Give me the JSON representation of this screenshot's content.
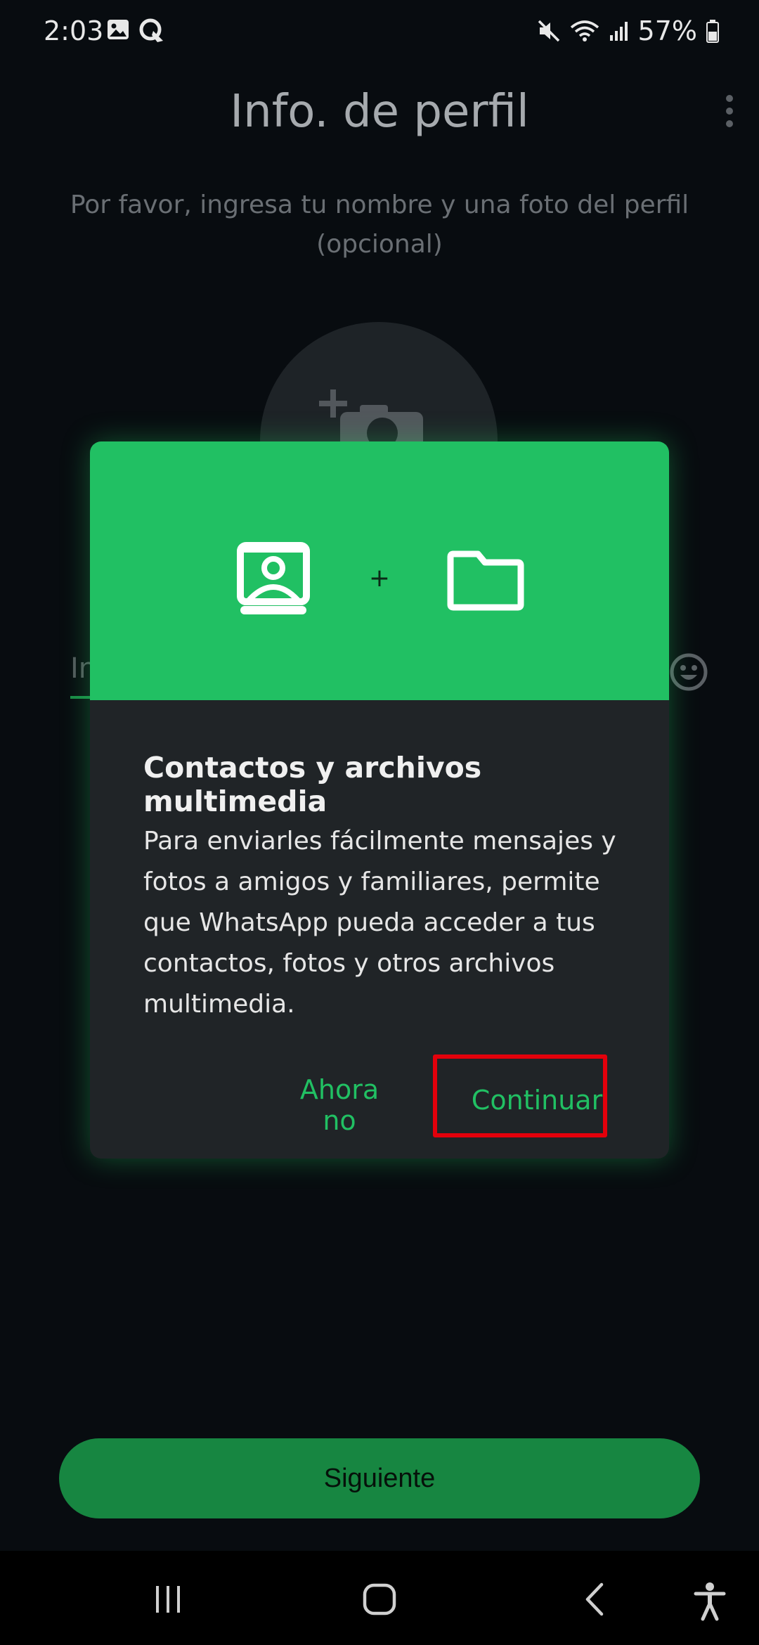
{
  "status_bar": {
    "time": "2:03",
    "battery": "57%",
    "icons_left": [
      "gallery-icon",
      "sync-icon"
    ],
    "icons_right": [
      "mute-icon",
      "wifi-icon",
      "signal-icon",
      "battery-icon"
    ]
  },
  "page": {
    "title": "Info. de perfil",
    "subtitle": "Por favor, ingresa tu nombre y una foto del perfil (opcional)",
    "name_placeholder": "In",
    "next_button": "Siguiente"
  },
  "dialog": {
    "title": "Contactos y archivos multimedia",
    "body": "Para enviarles fácilmente mensajes y fotos a amigos y familiares, permite que WhatsApp pueda acceder a tus contactos, fotos y otros archivos multimedia.",
    "plus": "+",
    "not_now": "Ahora no",
    "continue": "Continuar"
  },
  "colors": {
    "accent": "#21c063",
    "background": "#080c10",
    "dialog_bg": "#202427",
    "highlight": "#e3000b",
    "next_button_bg": "#178641"
  }
}
